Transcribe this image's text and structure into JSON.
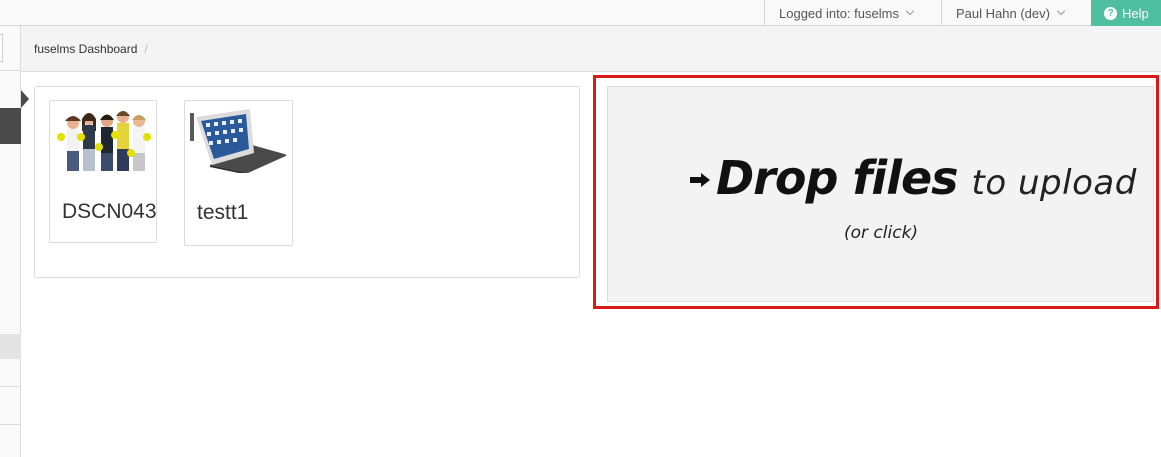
{
  "topbar": {
    "login_label": "Logged into: fuselms",
    "user_label": "Paul Hahn (dev)",
    "help_label": "Help"
  },
  "breadcrumb": {
    "items": [
      "fuselms Dashboard"
    ],
    "separator": "/"
  },
  "files": [
    {
      "name": "DSCN043",
      "thumbnail_icon": "group-photo-thumbnail"
    },
    {
      "name": "testt1",
      "thumbnail_icon": "tablet-photo-thumbnail"
    }
  ],
  "dropzone": {
    "strong_text": "Drop files",
    "light_text": "to upload",
    "sub_text": "(or click)",
    "highlight_color": "#d9181a"
  },
  "colors": {
    "help_accent": "#4fbf9f",
    "sidebar_active": "#4a4a4a"
  }
}
